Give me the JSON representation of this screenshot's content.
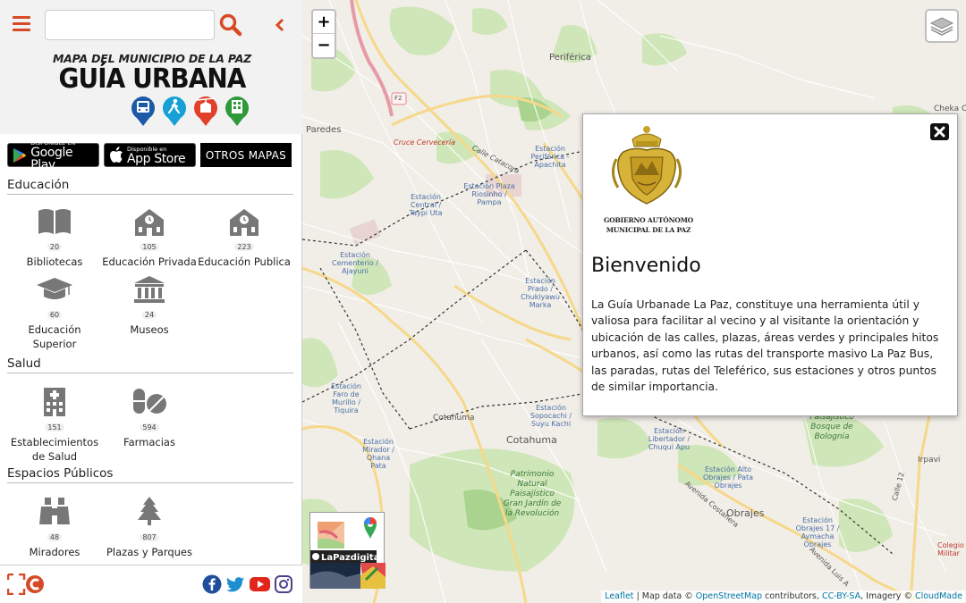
{
  "search": {
    "placeholder": "",
    "value": ""
  },
  "brand": {
    "subtitle": "MAPA DEL MUNICIPIO DE LA PAZ",
    "title": "GUÍA URBANA"
  },
  "stores": {
    "google_small": "DISPONIBLE EN",
    "google_big": "Google Play",
    "apple_small": "Disponible en",
    "apple_big": "App Store",
    "otros": "OTROS MAPAS"
  },
  "sections": {
    "educacion": {
      "title": "Educación",
      "items": [
        {
          "count": "20",
          "label": "Bibliotecas",
          "icon": "book-icon"
        },
        {
          "count": "105",
          "label": "Educación Privada",
          "icon": "school-icon"
        },
        {
          "count": "223",
          "label": "Educación Publica",
          "icon": "school-icon"
        },
        {
          "count": "60",
          "label": "Educación Superior",
          "icon": "graduation-cap-icon"
        },
        {
          "count": "24",
          "label": "Museos",
          "icon": "museum-icon"
        }
      ]
    },
    "salud": {
      "title": "Salud",
      "items": [
        {
          "count": "151",
          "label": "Establecimientos de Salud",
          "icon": "hospital-icon"
        },
        {
          "count": "594",
          "label": "Farmacias",
          "icon": "pills-icon"
        }
      ]
    },
    "espacios": {
      "title": "Espacios Públicos",
      "items": [
        {
          "count": "48",
          "label": "Miradores",
          "icon": "binoculars-icon"
        },
        {
          "count": "807",
          "label": "Plazas y Parques",
          "icon": "tree-icon"
        }
      ]
    }
  },
  "map": {
    "labels": {
      "periferica": "Periférica",
      "paredes": "Paredes",
      "cruce": "Cruce Cervecería",
      "calle_catacora": "Calle Catacora",
      "route": "F2",
      "cotahuma_small": "Cotahuma",
      "cotahuma_big": "Cotahuma",
      "obrajes": "Obrajes",
      "irpavi": "Irpavi",
      "cheka": "Cheka Ch",
      "avenida": "Avenida Costanera",
      "avenida_luis": "Avenida Luis A",
      "calle12": "Calle 12",
      "colegio": "Colegio Militar"
    },
    "stations": [
      "Estación Periférica - Apachita",
      "Estación Plaza Riosinho / Pampa",
      "Estación Central / Taypi Uta",
      "Estación Cementerio / Ajayuni",
      "Estación Prado / Chukiyawu Marka",
      "Estación Faro de Murillo / Tiquira",
      "Estación Sopocachi / Suyu Kachi",
      "Estación Mirador / Qhana Pata",
      "Estación Libertador / Chuqui Apu",
      "Estación Alto Obrajes / Pata Obrajes",
      "Estación Obrajes 17 / Aymacha Obrajes"
    ],
    "parks": {
      "patrimonio": "Patrimonio Natural Paisajístico Gran Jardín de la Revolución",
      "bosque": "Paisajístico Bosque de Bolognia"
    },
    "minimap_label": "LaPazdigital"
  },
  "zoom": {
    "in": "+",
    "out": "−"
  },
  "attribution": {
    "leaflet": "Leaflet",
    "sep1": " | Map data © ",
    "osm": "OpenStreetMap",
    "contributors": " contributors, ",
    "license": "CC-BY-SA",
    "imagery": ", Imagery © ",
    "cloudmade": "CloudMade"
  },
  "popup": {
    "gov_name": "GOBIERNO AUTÓNOMO MUNICIPAL DE LA PAZ",
    "title": "Bienvenido",
    "body": "La Guía Urbanade La Paz, constituye una herramienta útil y valiosa para facilitar al vecino y al visitante la orientación y ubicación de las calles, plazas, áreas verdes y principales hitos urbanos, así como las rutas del transporte masivo La Paz Bus, las paradas, rutas del Teleférico, sus estaciones y otros puntos de similar importancia."
  },
  "colors": {
    "accent": "#d64a26",
    "brand_blue": "#1c5aa8",
    "brand_cyan": "#16a0d6",
    "brand_red": "#e1402b",
    "brand_green": "#2e9a3b"
  },
  "social": [
    "facebook-icon",
    "twitter-icon",
    "youtube-icon",
    "instagram-icon"
  ]
}
